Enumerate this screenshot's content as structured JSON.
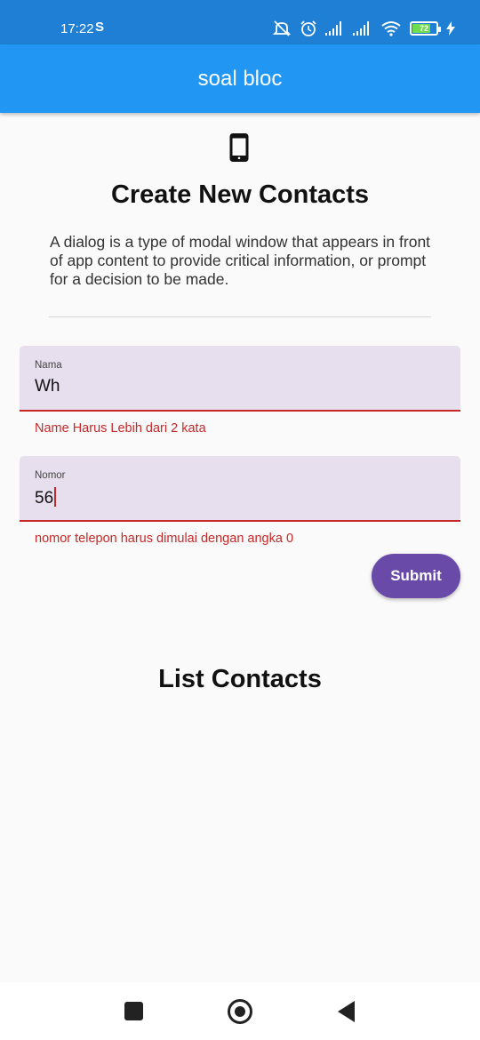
{
  "status_bar": {
    "time": "17:22",
    "carrier_glyph": "S",
    "battery": "72",
    "icons": [
      "mute-icon",
      "alarm-icon",
      "signal-icon",
      "signal-icon",
      "wifi-icon",
      "battery-icon",
      "charging-icon"
    ]
  },
  "app_bar": {
    "title": "soal bloc"
  },
  "header": {
    "icon": "phone-icon",
    "title": "Create New Contacts",
    "description": "A dialog is a type of modal window that appears in front of app content to provide critical information, or prompt for a decision to be made."
  },
  "form": {
    "name": {
      "label": "Nama",
      "value": "Wh",
      "error": "Name Harus Lebih dari 2 kata"
    },
    "number": {
      "label": "Nomor",
      "value": "56",
      "error": "nomor telepon harus dimulai dengan angka 0"
    },
    "submit_label": "Submit"
  },
  "list": {
    "title": "List Contacts"
  },
  "colors": {
    "app_bar": "#2196f3",
    "status_bar": "#1e7fd4",
    "field_fill": "#e8dfee",
    "error": "#c62828",
    "button": "#6a4aa8"
  }
}
